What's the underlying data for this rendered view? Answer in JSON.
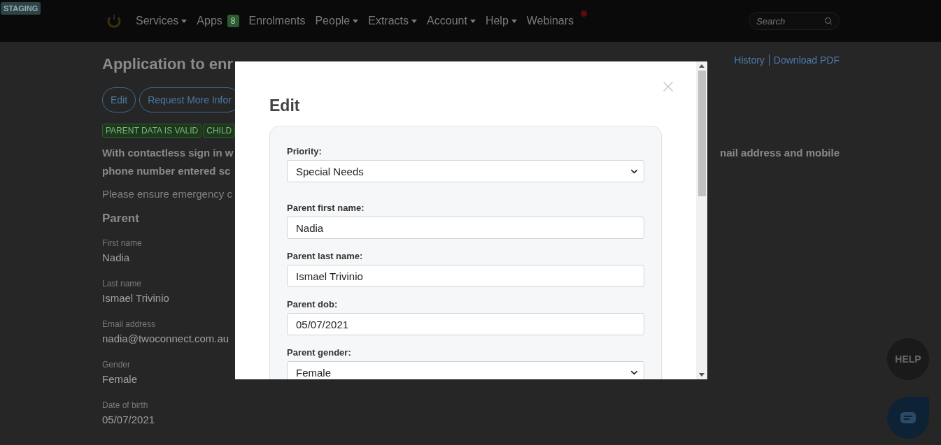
{
  "badge": "STAGING",
  "nav": {
    "items": [
      {
        "label": "Services",
        "dropdown": true,
        "notification": false
      },
      {
        "label": "Apps",
        "count": "8",
        "dropdown": false,
        "notification": false
      },
      {
        "label": "Enrolments",
        "dropdown": false,
        "notification": false
      },
      {
        "label": "People",
        "dropdown": true,
        "notification": false
      },
      {
        "label": "Extracts",
        "dropdown": true,
        "notification": false
      },
      {
        "label": "Account",
        "dropdown": true,
        "notification": false
      },
      {
        "label": "Help",
        "dropdown": true,
        "notification": false
      },
      {
        "label": "Webinars",
        "dropdown": false,
        "notification": true
      }
    ],
    "search": {
      "placeholder": "Search"
    }
  },
  "page": {
    "title": "Application to enr",
    "links": [
      "History",
      "Download PDF"
    ],
    "buttons": [
      "Edit",
      "Request More Infor"
    ],
    "tags": [
      "PARENT DATA IS VALID",
      "CHILD"
    ],
    "notice_lines": [
      "With contactless sign in w",
      "phone number entered sc"
    ],
    "notice_right": "nail address and mobile",
    "info": "Please ensure emergency c",
    "section": "Parent",
    "fields": [
      {
        "label": "First name",
        "value": "Nadia"
      },
      {
        "label": "Last name",
        "value": "Ismael Trivinio"
      },
      {
        "label": "Email address",
        "value": "nadia@twoconnect.com.au"
      },
      {
        "label": "Gender",
        "value": "Female"
      },
      {
        "label": "Date of birth",
        "value": "05/07/2021"
      }
    ]
  },
  "modal": {
    "title": "Edit",
    "fields": [
      {
        "label": "Priority:",
        "kind": "select",
        "value": "Special Needs"
      },
      {
        "label": "Parent first name:",
        "kind": "text",
        "value": "Nadia"
      },
      {
        "label": "Parent last name:",
        "kind": "text",
        "value": "Ismael Trivinio"
      },
      {
        "label": "Parent dob:",
        "kind": "text",
        "value": "05/07/2021"
      },
      {
        "label": "Parent gender:",
        "kind": "select",
        "value": "Female"
      }
    ]
  },
  "help": "HELP"
}
